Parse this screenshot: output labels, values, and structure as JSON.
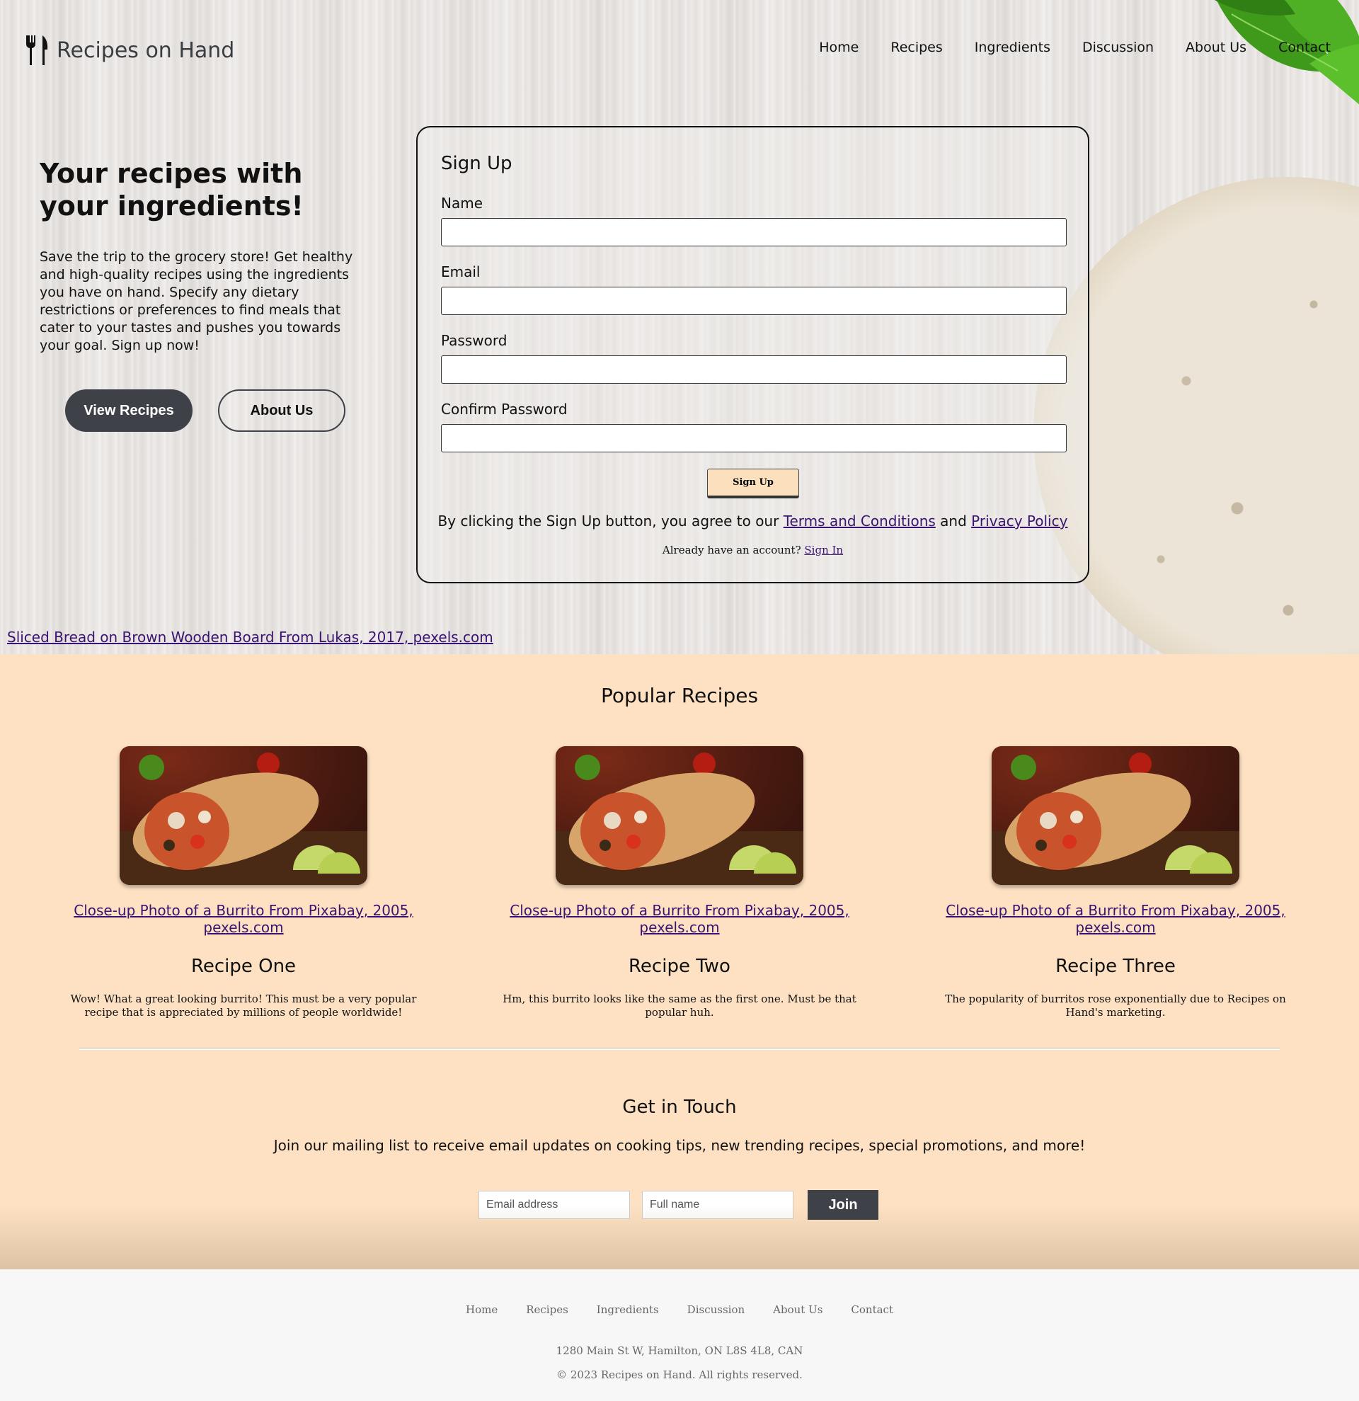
{
  "brand": {
    "name": "Recipes on Hand"
  },
  "nav": [
    "Home",
    "Recipes",
    "Ingredients",
    "Discussion",
    "About Us",
    "Contact"
  ],
  "hero": {
    "title": "Your recipes with your ingredients!",
    "text": "Save the trip to the grocery store! Get healthy and high-quality recipes using the ingredients you have on hand. Specify any dietary restrictions or preferences to find meals that cater to your tastes and pushes you towards your goal. Sign up now!",
    "view_button": "View Recipes",
    "about_button": "About Us",
    "image_credit": "Sliced Bread on Brown Wooden Board From Lukas, 2017, pexels.com"
  },
  "signup": {
    "title": "Sign Up",
    "name_label": "Name",
    "email_label": "Email",
    "password_label": "Password",
    "confirm_label": "Confirm Password",
    "submit": "Sign Up",
    "agree_prefix": "By clicking the Sign Up button, you agree to our ",
    "terms_link": "Terms and Conditions",
    "agree_and": " and ",
    "privacy_link": "Privacy Policy",
    "already_text": "Already have an account? ",
    "signin_link": "Sign In"
  },
  "popular": {
    "title": "Popular Recipes",
    "recipes": [
      {
        "credit": "Close-up Photo of a Burrito From Pixabay, 2005, pexels.com",
        "title": "Recipe One",
        "desc": "Wow! What a great looking burrito! This must be a very popular recipe that is appreciated by millions of people worldwide!"
      },
      {
        "credit": "Close-up Photo of a Burrito From Pixabay, 2005, pexels.com",
        "title": "Recipe Two",
        "desc": "Hm, this burrito looks like the same as the first one. Must be that popular huh."
      },
      {
        "credit": "Close-up Photo of a Burrito From Pixabay, 2005, pexels.com",
        "title": "Recipe Three",
        "desc": "The popularity of burritos rose exponentially due to Recipes on Hand's marketing."
      }
    ]
  },
  "touch": {
    "title": "Get in Touch",
    "text": "Join our mailing list to receive email updates on cooking tips, new trending recipes, special promotions, and more!",
    "email_placeholder": "Email address",
    "name_placeholder": "Full name",
    "join": "Join"
  },
  "footer": {
    "nav": [
      "Home",
      "Recipes",
      "Ingredients",
      "Discussion",
      "About Us",
      "Contact"
    ],
    "address": "1280 Main St W, Hamilton, ON L8S 4L8, CAN",
    "copyright": "© 2023 Recipes on Hand. All rights reserved."
  },
  "colors": {
    "dark_button": "#3e4147",
    "peach": "#fde1c2",
    "signup_button": "#fce0bd",
    "link": "#3a1470"
  }
}
